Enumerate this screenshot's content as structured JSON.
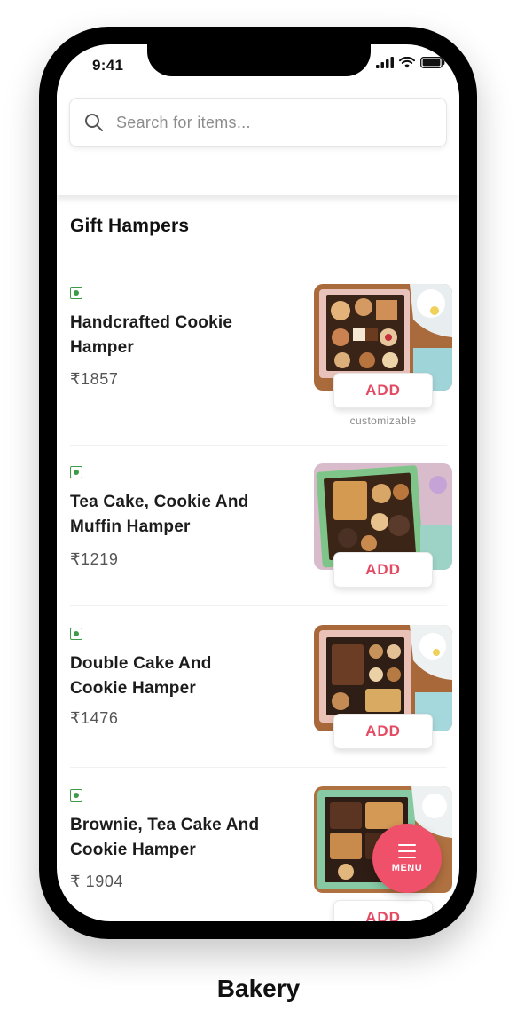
{
  "status_bar": {
    "time": "9:41"
  },
  "search": {
    "placeholder": "Search for items..."
  },
  "section": {
    "title": "Gift Hampers"
  },
  "items": [
    {
      "name_line1": "Handcrafted Cookie",
      "name_line2": "Hamper",
      "price": "₹1857",
      "add_label": "ADD",
      "note": "customizable"
    },
    {
      "name_line1": "Tea Cake, Cookie And",
      "name_line2": "Muffin Hamper",
      "price": "₹1219",
      "add_label": "ADD"
    },
    {
      "name_line1": "Double Cake And",
      "name_line2": "Cookie Hamper",
      "price": "₹1476",
      "add_label": "ADD"
    },
    {
      "name_line1": "Brownie, Tea Cake And",
      "name_line2": "Cookie Hamper",
      "price": "₹ 1904",
      "add_label": "ADD"
    }
  ],
  "menu_button": {
    "label": "MENU",
    "icon": "hamburger-icon"
  },
  "caption": "Bakery",
  "colors": {
    "accent": "#ef506a",
    "add_text": "#e24b63",
    "veg_green": "#3c9b47"
  }
}
